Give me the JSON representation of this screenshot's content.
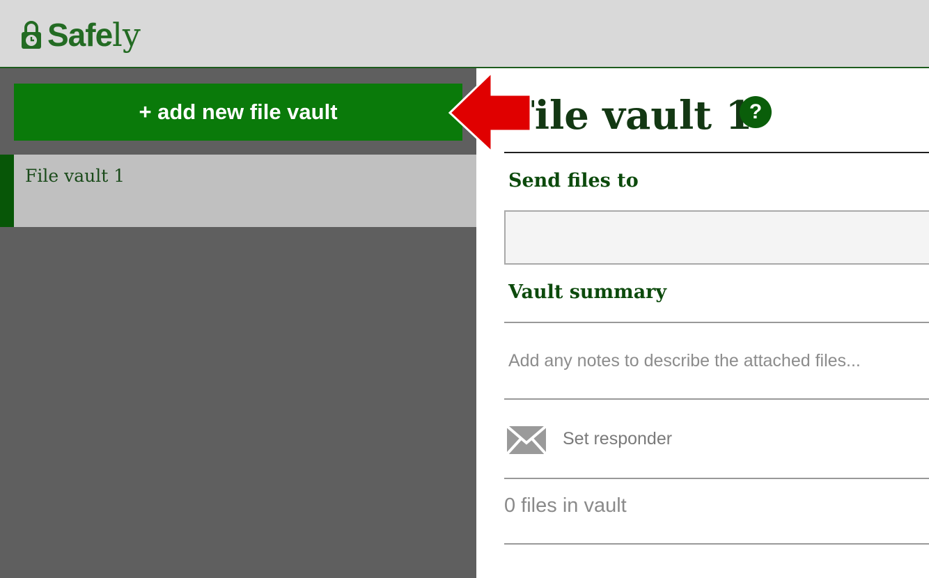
{
  "app": {
    "logo_bold": "Safe",
    "logo_light": "ly"
  },
  "sidebar": {
    "add_button_label": "+ add new file vault",
    "vaults": [
      {
        "label": "File vault 1",
        "selected": true
      }
    ]
  },
  "vault": {
    "title": "File vault 1",
    "help_icon_glyph": "?",
    "send_files_label": "Send files to",
    "send_files_value": "",
    "summary_label": "Vault summary",
    "notes_placeholder": "Add any notes to describe the attached files...",
    "responder_label": "Set responder",
    "files_count_text": "0 files in vault"
  },
  "annotation": {
    "arrow_color": "#e00000",
    "arrow_target": "add-new-vault-button"
  },
  "colors": {
    "brand_green": "#0a7a0a",
    "sidebar_bg": "#5f5f5f",
    "selected_item_bg": "#c0c0c0"
  },
  "icons": {
    "logo": "lock-clock-icon",
    "help": "help-icon",
    "responder": "mail-icon",
    "annotation": "red-arrow-icon"
  }
}
